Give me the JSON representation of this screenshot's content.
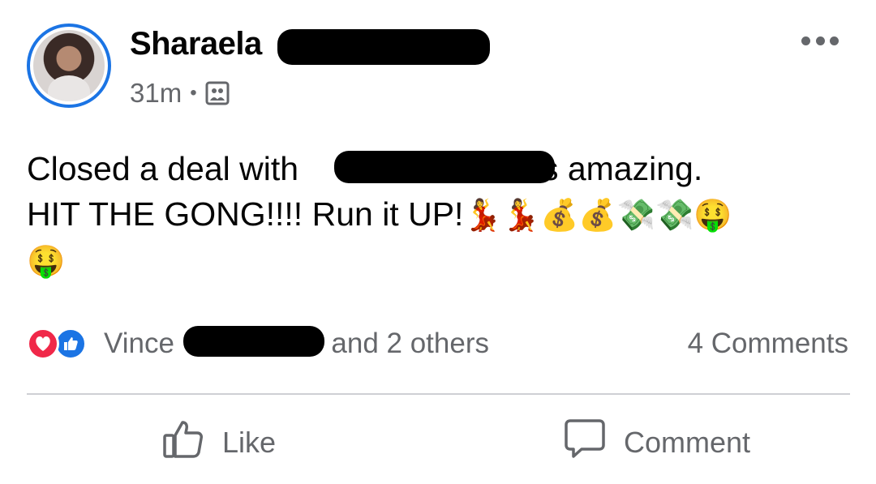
{
  "post": {
    "author_name": "Sharaela",
    "timestamp": "31m",
    "separator": "•",
    "audience_icon": "group-photo-icon",
    "more_icon": "more-horizontal-icon",
    "body_line1_before": "Closed a deal with",
    "body_line1_after": "is amazing.",
    "body_line2_text": "HIT THE GONG!!!! Run it UP!",
    "body_line2_emojis": "💃💃💰💰💸💸🤑",
    "body_line3_emojis": "🤑"
  },
  "reactions": {
    "icons": [
      "love-reaction-icon",
      "like-reaction-icon"
    ],
    "name_start": "Vince",
    "name_end": "and 2 others",
    "comments_count": "4 Comments"
  },
  "actions": {
    "like_label": "Like",
    "comment_label": "Comment"
  },
  "colors": {
    "accent": "#1b74e4",
    "love": "#f02849",
    "secondary_text": "#65676b",
    "divider": "#ced0d4"
  }
}
